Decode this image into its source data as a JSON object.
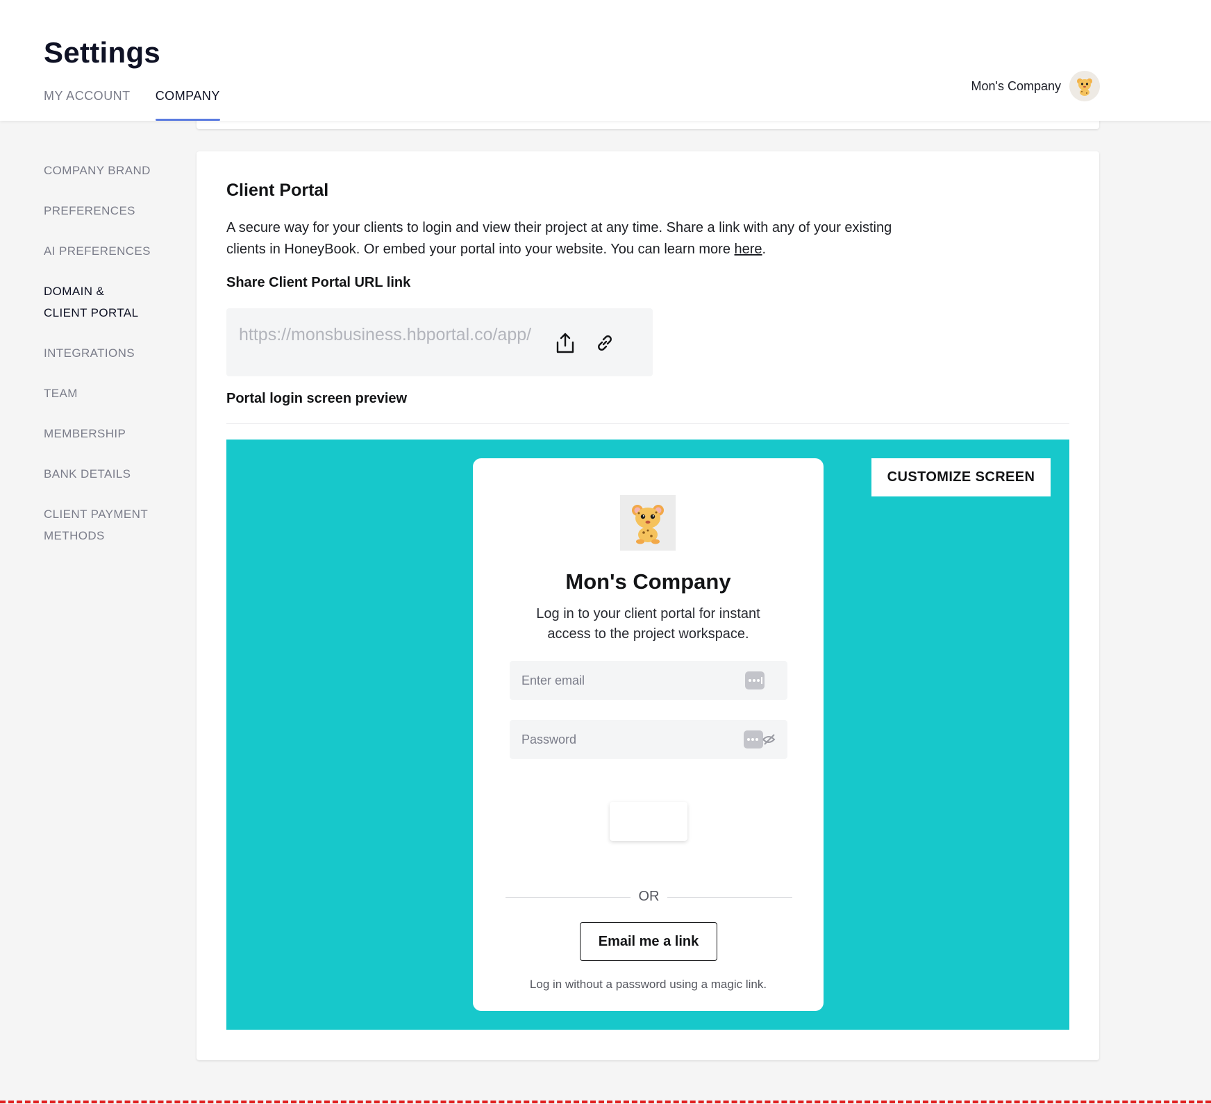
{
  "header": {
    "title": "Settings",
    "tabs": [
      {
        "label": "MY ACCOUNT",
        "active": false
      },
      {
        "label": "COMPANY",
        "active": true
      }
    ],
    "company_name": "Mon's Company",
    "accent_color": "#5b7be0"
  },
  "sidebar": {
    "items": [
      {
        "label": "COMPANY BRAND",
        "active": false
      },
      {
        "label": "PREFERENCES",
        "active": false
      },
      {
        "label": "AI PREFERENCES",
        "active": false
      },
      {
        "label": "DOMAIN & CLIENT PORTAL",
        "active": true
      },
      {
        "label": "INTEGRATIONS",
        "active": false
      },
      {
        "label": "TEAM",
        "active": false
      },
      {
        "label": "MEMBERSHIP",
        "active": false
      },
      {
        "label": "BANK DETAILS",
        "active": false
      },
      {
        "label": "CLIENT PAYMENT METHODS",
        "active": false
      }
    ]
  },
  "client_portal": {
    "title": "Client Portal",
    "description": "A secure way for your clients to login and view their project at any time. Share a link with any of your existing clients in HoneyBook. Or embed your portal into your website. You can learn more ",
    "learn_more_link": "here",
    "description_end": ".",
    "share_label": "Share Client Portal URL link",
    "url": "https://monsbusiness.hbportal.co/app/",
    "share_icon": "share-upload-icon",
    "copy_icon": "link-icon",
    "preview_label": "Portal login screen preview"
  },
  "preview": {
    "background_color": "#17c8cb",
    "customize_button": "CUSTOMIZE SCREEN",
    "login": {
      "company_name": "Mon's Company",
      "tagline": "Log in to your client portal for instant access to the project workspace.",
      "email_placeholder": "Enter email",
      "password_placeholder": "Password",
      "or_text": "OR",
      "email_link_button": "Email me a link",
      "magic_note": "Log in without a password using a magic link."
    }
  }
}
